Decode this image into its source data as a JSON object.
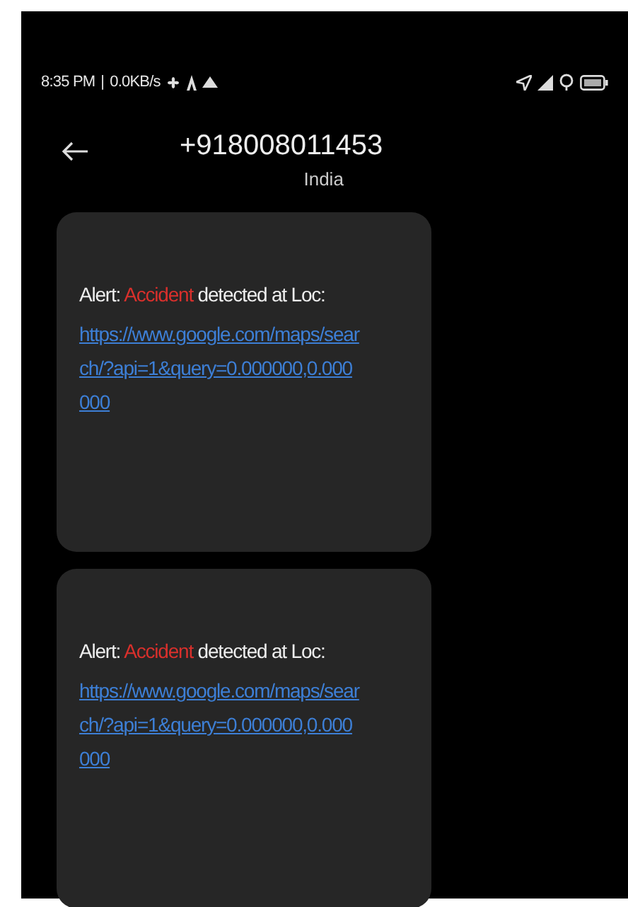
{
  "status_bar": {
    "time": "8:35 PM",
    "separator": "|",
    "speed": "0.0KB/s"
  },
  "header": {
    "title": "+918008011453",
    "subtitle": "India"
  },
  "messages": [
    {
      "parts": [
        {
          "kind": "plain",
          "text": "Alert: "
        },
        {
          "kind": "highlight",
          "text": "Accident"
        },
        {
          "kind": "plain",
          "text": " detected  at Loc:"
        }
      ],
      "link": "https://www.google.com/maps/search/?api=1&query=0.000000,0.000000"
    },
    {
      "parts": [
        {
          "kind": "plain",
          "text": "Alert: "
        },
        {
          "kind": "highlight",
          "text": "Accident"
        },
        {
          "kind": "plain",
          "text": " detected  at Loc:"
        }
      ],
      "link": "https://www.google.com/maps/search/?api=1&query=0.000000,0.000000"
    }
  ]
}
